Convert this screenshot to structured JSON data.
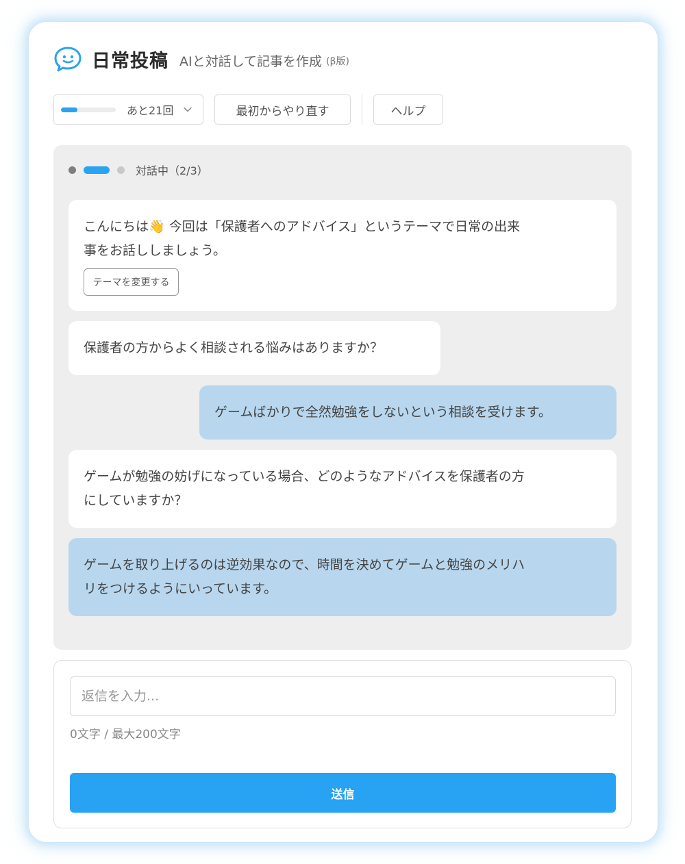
{
  "header": {
    "logo_icon": "chat-bubble-face-icon",
    "title": "日常投稿",
    "subtitle": "AIと対話して記事を作成",
    "beta": "(β版)"
  },
  "toolbar": {
    "remaining_label": "あと21回",
    "remaining_progress_percent": 30,
    "restart_label": "最初からやり直す",
    "help_label": "ヘルプ"
  },
  "chat": {
    "status_text": "対話中（2/3）",
    "messages": [
      {
        "role": "ai",
        "lines": [
          "こんにちは👋 今回は「保護者へのアドバイス」というテーマで日常の出来",
          "事をお話ししましょう。"
        ],
        "action_label": "テーマを変更する"
      },
      {
        "role": "ai",
        "lines": [
          "保護者の方からよく相談される悩みはありますか？"
        ]
      },
      {
        "role": "user",
        "lines": [
          "ゲームばかりで全然勉強をしないという相談を受けます。"
        ]
      },
      {
        "role": "ai",
        "lines": [
          "ゲームが勉強の妨げになっている場合、どのようなアドバイスを保護者の方",
          "にしていますか？"
        ]
      },
      {
        "role": "user",
        "lines": [
          "ゲームを取り上げるのは逆効果なので、時間を決めてゲームと勉強のメリハ",
          "リをつけるようにいっています。"
        ]
      }
    ]
  },
  "compose": {
    "value": "",
    "placeholder": "返信を入力...",
    "char_count": "0文字 / 最大200文字",
    "send_label": "送信"
  },
  "colors": {
    "accent": "#2aa3f0",
    "user_bubble": "#b8d7ee",
    "chat_bg": "#eeeeee"
  }
}
